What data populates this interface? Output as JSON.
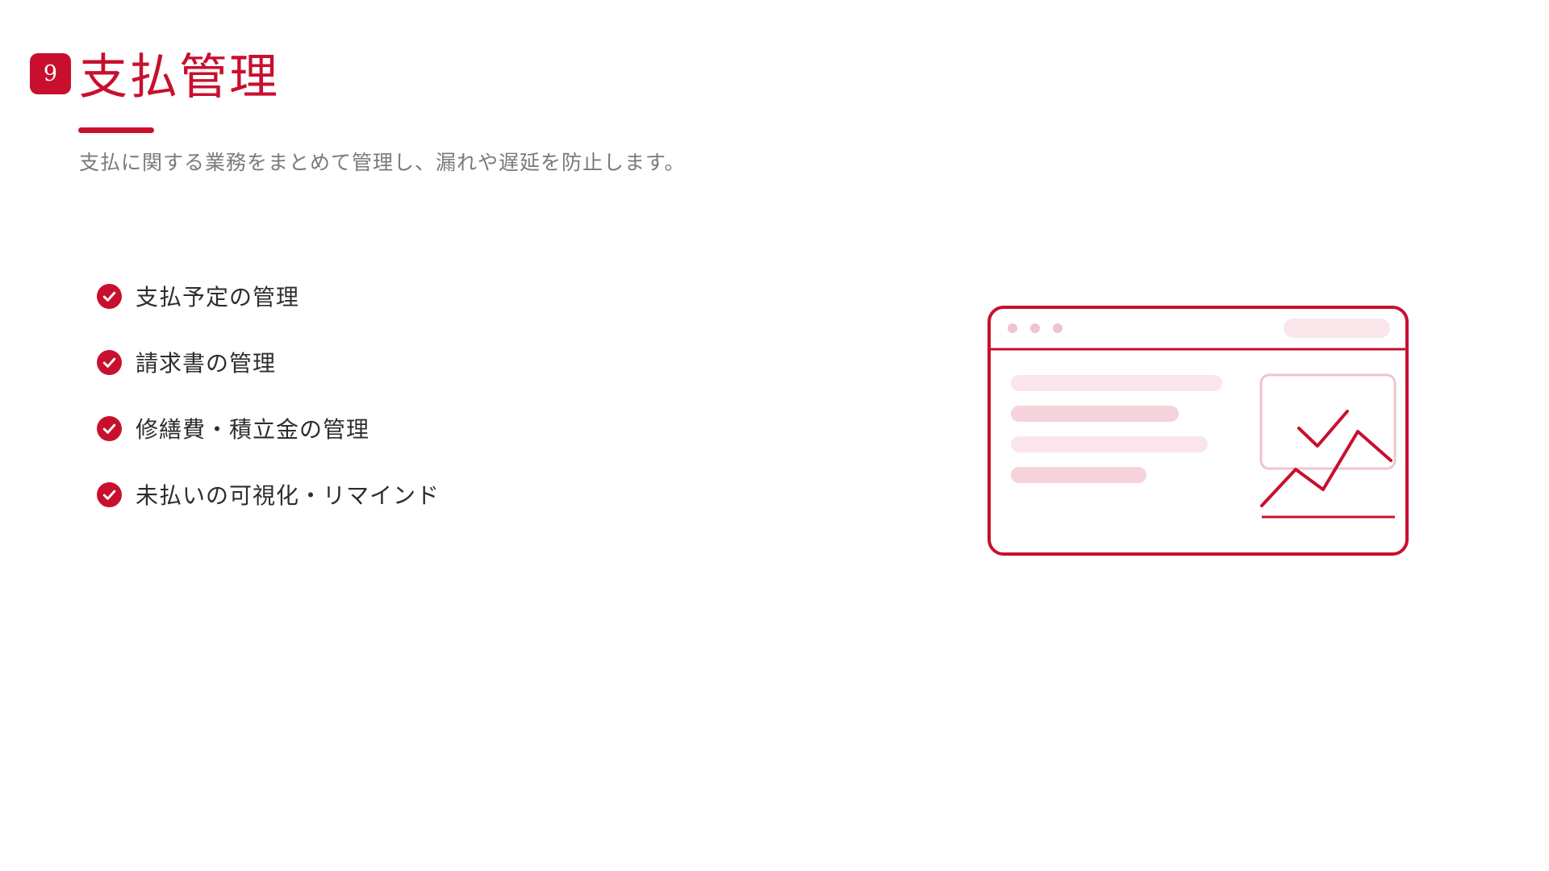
{
  "header": {
    "number": "9",
    "title": "支払管理",
    "subtitle": "支払に関する業務をまとめて管理し、漏れや遅延を防止します。"
  },
  "features": [
    {
      "label": "支払予定の管理",
      "icon": "check-circle-icon"
    },
    {
      "label": "請求書の管理",
      "icon": "check-circle-icon"
    },
    {
      "label": "修繕費・積立金の管理",
      "icon": "check-circle-icon"
    },
    {
      "label": "未払いの可視化・リマインド",
      "icon": "check-circle-icon"
    }
  ],
  "illustration": {
    "icon": "browser-dashboard-illustration",
    "window_dots": 3
  },
  "colors": {
    "accent": "#c8102e",
    "accent_light": "#f5d3da",
    "accent_faint": "#fae6ea",
    "text": "#2d2d2d",
    "muted": "#7a7a7a",
    "background": "#ffffff"
  }
}
